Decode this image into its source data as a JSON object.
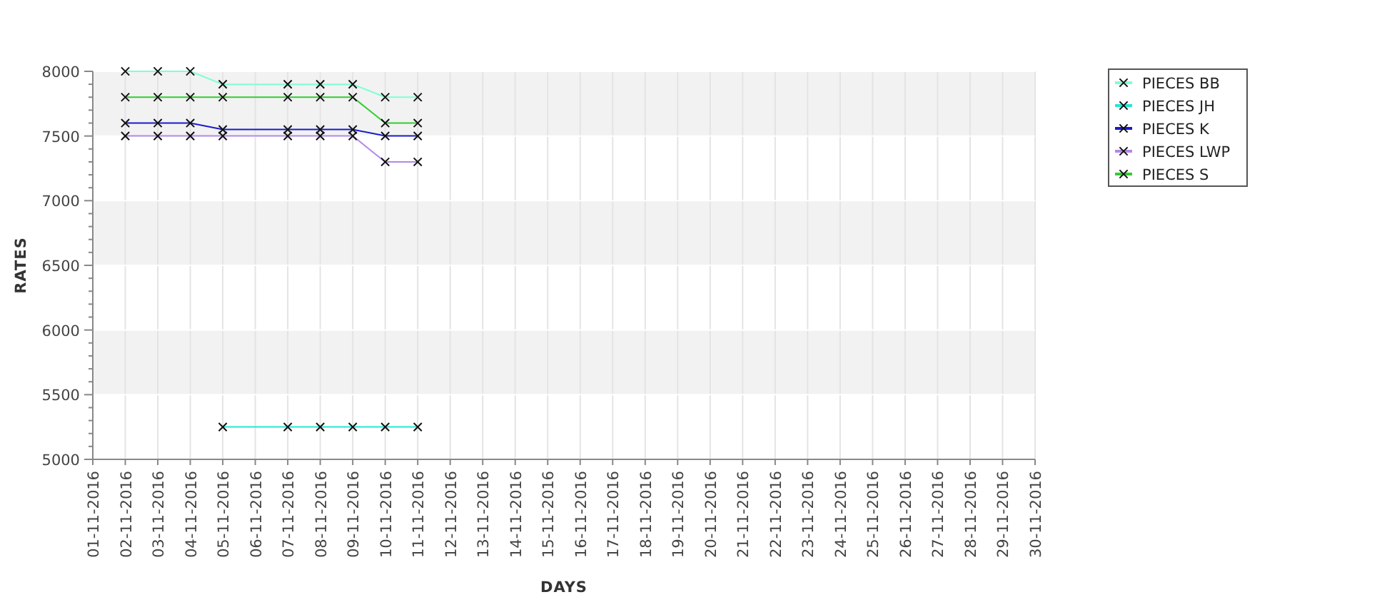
{
  "chart_data": {
    "type": "line",
    "xlabel": "DAYS",
    "ylabel": "RATES",
    "categories": [
      "01-11-2016",
      "02-11-2016",
      "03-11-2016",
      "04-11-2016",
      "05-11-2016",
      "06-11-2016",
      "07-11-2016",
      "08-11-2016",
      "09-11-2016",
      "10-11-2016",
      "11-11-2016",
      "12-11-2016",
      "13-11-2016",
      "14-11-2016",
      "15-11-2016",
      "16-11-2016",
      "17-11-2016",
      "18-11-2016",
      "19-11-2016",
      "20-11-2016",
      "21-11-2016",
      "22-11-2016",
      "23-11-2016",
      "24-11-2016",
      "25-11-2016",
      "26-11-2016",
      "27-11-2016",
      "28-11-2016",
      "29-11-2016",
      "30-11-2016"
    ],
    "ylim": [
      5000,
      8000
    ],
    "grid": true,
    "legend": true,
    "yticks": [
      5000,
      5500,
      6000,
      6500,
      7000,
      7500,
      8000
    ],
    "series": [
      {
        "name": "PIECES BB",
        "color": "#7fffd4",
        "marker": "x",
        "values": [
          null,
          8000,
          8000,
          8000,
          7900,
          null,
          7900,
          7900,
          7900,
          7800,
          7800,
          null,
          null,
          null,
          null,
          null,
          null,
          null,
          null,
          null,
          null,
          null,
          null,
          null,
          null,
          null,
          null,
          null,
          null,
          null
        ]
      },
      {
        "name": "PIECES JH",
        "color": "#22e8d0",
        "marker": "x",
        "values": [
          null,
          null,
          null,
          null,
          5250,
          null,
          5250,
          5250,
          5250,
          5250,
          5250,
          null,
          null,
          null,
          null,
          null,
          null,
          null,
          null,
          null,
          null,
          null,
          null,
          null,
          null,
          null,
          null,
          null,
          null,
          null
        ]
      },
      {
        "name": "PIECES K",
        "color": "#1a1acc",
        "marker": "x",
        "values": [
          null,
          7600,
          7600,
          7600,
          7550,
          null,
          7550,
          7550,
          7550,
          7500,
          7500,
          null,
          null,
          null,
          null,
          null,
          null,
          null,
          null,
          null,
          null,
          null,
          null,
          null,
          null,
          null,
          null,
          null,
          null,
          null
        ]
      },
      {
        "name": "PIECES LWP",
        "color": "#b487e8",
        "marker": "x",
        "values": [
          null,
          7500,
          7500,
          7500,
          7500,
          null,
          7500,
          7500,
          7500,
          7300,
          7300,
          null,
          null,
          null,
          null,
          null,
          null,
          null,
          null,
          null,
          null,
          null,
          null,
          null,
          null,
          null,
          null,
          null,
          null,
          null
        ]
      },
      {
        "name": "PIECES S",
        "color": "#33cc33",
        "marker": "x",
        "values": [
          null,
          7800,
          7800,
          7800,
          7800,
          null,
          7800,
          7800,
          7800,
          7600,
          7600,
          null,
          null,
          null,
          null,
          null,
          null,
          null,
          null,
          null,
          null,
          null,
          null,
          null,
          null,
          null,
          null,
          null,
          null,
          null
        ]
      }
    ]
  }
}
